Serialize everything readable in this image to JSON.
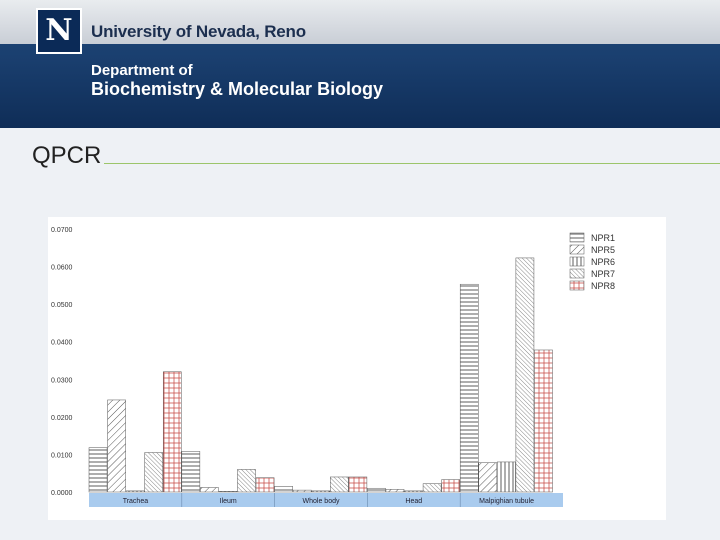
{
  "header": {
    "logo_letter": "N",
    "university": "University of Nevada, Reno",
    "department_line1": "Department of",
    "department_line2": "Biochemistry & Molecular Biology"
  },
  "slide": {
    "title": "QPCR"
  },
  "colors": {
    "header_blue": "#1a3f6f",
    "rule_green": "#9cc56a",
    "category_band": "#a9cbee",
    "npr8_red": "#c9524c"
  },
  "chart_data": {
    "type": "bar",
    "title": "",
    "xlabel": "",
    "ylabel": "",
    "ylim": [
      0,
      0.07
    ],
    "yticks": [
      "0.0000",
      "0.0100",
      "0.0200",
      "0.0300",
      "0.0400",
      "0.0500",
      "0.0600",
      "0.0700"
    ],
    "grid": false,
    "legend": "top-right",
    "categories": [
      "Trachea",
      "Ileum",
      "Whole body",
      "Head",
      "Malpighian tubule"
    ],
    "series": [
      {
        "name": "NPR1",
        "pattern": "horizontal",
        "values": [
          0.0118,
          0.0108,
          0.0015,
          0.001,
          0.0553
        ]
      },
      {
        "name": "NPR5",
        "pattern": "diagonal",
        "values": [
          0.0245,
          0.0012,
          0.0005,
          0.0007,
          0.0078
        ]
      },
      {
        "name": "NPR6",
        "pattern": "vertical",
        "values": [
          0.0003,
          0.0002,
          0.0003,
          0.0003,
          0.008
        ]
      },
      {
        "name": "NPR7",
        "pattern": "diagonal-fine",
        "values": [
          0.0105,
          0.006,
          0.004,
          0.0022,
          0.0623
        ]
      },
      {
        "name": "NPR8",
        "pattern": "grid-red",
        "values": [
          0.032,
          0.0038,
          0.004,
          0.0033,
          0.0378
        ]
      }
    ]
  }
}
